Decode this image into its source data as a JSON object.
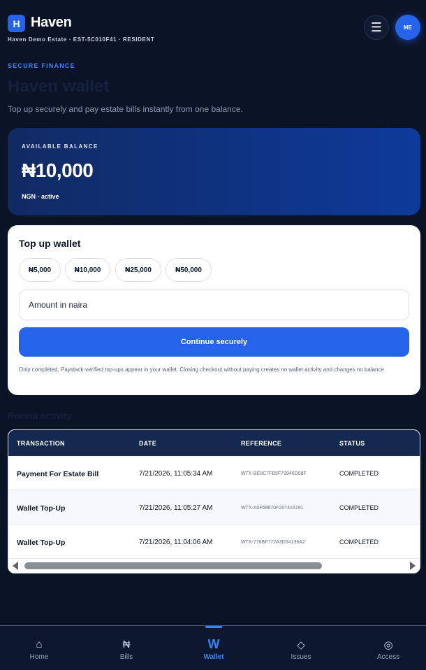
{
  "header": {
    "logo_letter": "H",
    "app_name": "Haven",
    "estate_line": "Haven Demo Estate · EST-5C010F41 · RESIDENT",
    "menu_icon": "☰",
    "avatar_initials": "ME"
  },
  "intro": {
    "eyebrow": "SECURE FINANCE",
    "title": "Haven wallet",
    "subtitle": "Top up securely and pay estate bills instantly from one balance."
  },
  "balance": {
    "label": "AVAILABLE BALANCE",
    "amount": "₦10,000",
    "currency_status": "NGN · active"
  },
  "topup": {
    "title": "Top up wallet",
    "presets": [
      "₦5,000",
      "₦10,000",
      "₦25,000",
      "₦50,000"
    ],
    "amount_placeholder": "Amount in naira",
    "amount_value": "",
    "continue_label": "Continue securely",
    "note": "Only completed, Paystack-verified top-ups appear in your wallet. Closing checkout without paying creates no wallet activity and changes no balance."
  },
  "recent": {
    "title": "Recent activity",
    "columns": [
      "TRANSACTION",
      "DATE",
      "REFERENCE",
      "STATUS"
    ],
    "rows": [
      {
        "transaction": "Payment For Estate Bill",
        "date": "7/21/2026, 11:05:34 AM",
        "reference": "WTX-BE8C7FB5F79945D08F",
        "status": "COMPLETED"
      },
      {
        "transaction": "Wallet Top-Up",
        "date": "7/21/2026, 11:05:27 AM",
        "reference": "WTX-A0F69670F207415191",
        "status": "COMPLETED"
      },
      {
        "transaction": "Wallet Top-Up",
        "date": "7/21/2026, 11:04:06 AM",
        "reference": "WTX-776BF772A3D54136A2",
        "status": "COMPLETED"
      }
    ]
  },
  "nav": {
    "items": [
      {
        "label": "Home",
        "icon": "⌂",
        "icon_name": "home-icon"
      },
      {
        "label": "Bills",
        "icon": "₦",
        "icon_name": "naira-icon"
      },
      {
        "label": "Wallet",
        "icon": "W",
        "icon_name": "wallet-icon",
        "active": true
      },
      {
        "label": "Issues",
        "icon": "◇",
        "icon_name": "diamond-icon"
      },
      {
        "label": "Access",
        "icon": "◎",
        "icon_name": "access-icon"
      }
    ]
  },
  "colors": {
    "background": "#0b1427",
    "accent": "#2563eb",
    "balance_card": "#0e3a9a",
    "table_header": "#13294f"
  }
}
